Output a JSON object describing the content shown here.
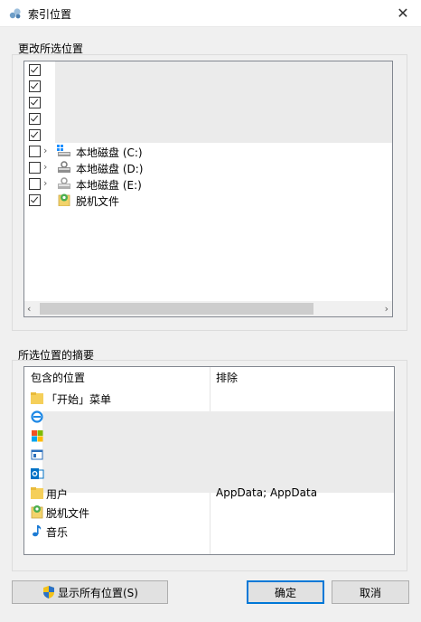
{
  "window": {
    "title": "索引位置"
  },
  "change_group": {
    "label": "更改所选位置",
    "rows": [
      {
        "checked": true
      },
      {
        "checked": true
      },
      {
        "checked": true
      },
      {
        "checked": true
      },
      {
        "checked": true
      },
      {
        "checked": false,
        "label": "本地磁盘 (C:)",
        "icon": "system-drive-icon",
        "expandable": true
      },
      {
        "checked": false,
        "label": "本地磁盘 (D:)",
        "icon": "locked-drive-icon",
        "expandable": true
      },
      {
        "checked": false,
        "label": "本地磁盘 (E:)",
        "icon": "locked-drive-icon",
        "expandable": true
      },
      {
        "checked": true,
        "label": "脱机文件",
        "icon": "offline-files-icon",
        "expandable": false
      }
    ]
  },
  "summary_group": {
    "label": "所选位置的摘要",
    "columns": {
      "included": "包含的位置",
      "excluded": "排除"
    },
    "rows": [
      {
        "included": "「开始」菜单",
        "excluded": "",
        "icon": "folder-icon"
      },
      {
        "included": "",
        "excluded": "",
        "icon": "internet-explorer-icon"
      },
      {
        "included": "",
        "excluded": "",
        "icon": "windows-icon"
      },
      {
        "included": "",
        "excluded": "",
        "icon": "window-app-icon"
      },
      {
        "included": "",
        "excluded": "",
        "icon": "outlook-icon"
      },
      {
        "included": "用户",
        "excluded": "AppData; AppData",
        "icon": "folder-icon"
      },
      {
        "included": "脱机文件",
        "excluded": "",
        "icon": "offline-files-icon"
      },
      {
        "included": "音乐",
        "excluded": "",
        "icon": "music-note-icon"
      }
    ]
  },
  "buttons": {
    "show_all": "显示所有位置(S)",
    "ok": "确定",
    "cancel": "取消"
  }
}
